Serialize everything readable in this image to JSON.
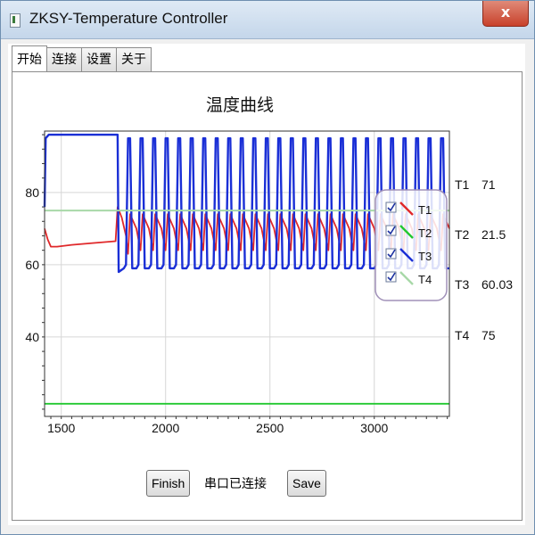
{
  "window": {
    "title": "ZKSY-Temperature Controller",
    "close_glyph": "x",
    "icon": "app-icon"
  },
  "tabs": [
    {
      "label": "开始",
      "active": true
    },
    {
      "label": "连接",
      "active": false
    },
    {
      "label": "设置",
      "active": false
    },
    {
      "label": "关于",
      "active": false
    }
  ],
  "chart_data": {
    "type": "line",
    "title": "温度曲线",
    "xlabel": "",
    "ylabel": "",
    "xlim": [
      1420,
      3360
    ],
    "ylim": [
      18,
      97
    ],
    "xticks": [
      1500,
      2000,
      2500,
      3000
    ],
    "yticks": [
      40,
      60,
      80
    ],
    "grid": true,
    "legend_position": "top-right",
    "series": [
      {
        "name": "T1",
        "color": "#e0282a",
        "values": [
          [
            1420,
            70
          ],
          [
            1435,
            67
          ],
          [
            1450,
            65
          ],
          [
            1480,
            65
          ],
          [
            1550,
            65.5
          ],
          [
            1650,
            66
          ],
          [
            1760,
            66.5
          ],
          [
            1770,
            76
          ],
          [
            1790,
            73
          ],
          [
            1810,
            68
          ],
          [
            1820,
            63
          ],
          [
            1830,
            74
          ],
          [
            1860,
            70
          ],
          [
            1880,
            64
          ],
          [
            1890,
            74
          ],
          [
            1920,
            70
          ],
          [
            1940,
            64
          ],
          [
            1950,
            74
          ],
          [
            1980,
            70
          ],
          [
            2000,
            64
          ],
          [
            2010,
            74
          ],
          [
            2040,
            70
          ],
          [
            2060,
            64
          ],
          [
            2070,
            74
          ],
          [
            2100,
            70
          ],
          [
            2120,
            64
          ],
          [
            2130,
            74
          ],
          [
            2160,
            70
          ],
          [
            2180,
            64
          ],
          [
            2190,
            74
          ],
          [
            2220,
            70
          ],
          [
            2240,
            64
          ],
          [
            2250,
            74
          ],
          [
            2280,
            70
          ],
          [
            2300,
            64
          ],
          [
            2310,
            74
          ],
          [
            2340,
            70
          ],
          [
            2360,
            64
          ],
          [
            2370,
            74
          ],
          [
            2400,
            70
          ],
          [
            2420,
            64
          ],
          [
            2430,
            74
          ],
          [
            2460,
            70
          ],
          [
            2480,
            64
          ],
          [
            2490,
            74
          ],
          [
            2520,
            70
          ],
          [
            2540,
            64
          ],
          [
            2550,
            74
          ],
          [
            2580,
            70
          ],
          [
            2600,
            64
          ],
          [
            2610,
            74
          ],
          [
            2640,
            70
          ],
          [
            2660,
            64
          ],
          [
            2670,
            74
          ],
          [
            2700,
            70
          ],
          [
            2720,
            64
          ],
          [
            2730,
            74
          ],
          [
            2760,
            70
          ],
          [
            2780,
            64
          ],
          [
            2790,
            74
          ],
          [
            2820,
            70
          ],
          [
            2840,
            64
          ],
          [
            2850,
            74
          ],
          [
            2880,
            70
          ],
          [
            2900,
            64
          ],
          [
            2910,
            74
          ],
          [
            2940,
            70
          ],
          [
            2960,
            64
          ],
          [
            2970,
            74
          ],
          [
            3000,
            70
          ],
          [
            3020,
            64
          ],
          [
            3030,
            74
          ],
          [
            3060,
            70
          ],
          [
            3080,
            64
          ],
          [
            3090,
            74
          ],
          [
            3120,
            70
          ],
          [
            3140,
            64
          ],
          [
            3150,
            74
          ],
          [
            3180,
            70
          ],
          [
            3200,
            64
          ],
          [
            3210,
            74
          ],
          [
            3240,
            70
          ],
          [
            3260,
            64
          ],
          [
            3270,
            74
          ],
          [
            3300,
            70
          ],
          [
            3320,
            64
          ],
          [
            3330,
            74
          ],
          [
            3360,
            70
          ]
        ]
      },
      {
        "name": "T2",
        "color": "#22c830",
        "values": [
          [
            1420,
            21.5
          ],
          [
            3360,
            21.5
          ]
        ]
      },
      {
        "name": "T3",
        "color": "#1a2fd6",
        "values": [
          [
            1420,
            76
          ],
          [
            1425,
            95
          ],
          [
            1440,
            96
          ],
          [
            1760,
            96
          ],
          [
            1770,
            96
          ],
          [
            1775,
            58
          ],
          [
            1800,
            59
          ],
          [
            1810,
            60
          ],
          [
            1820,
            95
          ],
          [
            1830,
            95
          ],
          [
            1840,
            59
          ],
          [
            1860,
            59
          ],
          [
            1870,
            60
          ],
          [
            1880,
            95
          ],
          [
            1890,
            95
          ],
          [
            1900,
            59
          ],
          [
            1920,
            59
          ],
          [
            1930,
            60
          ],
          [
            1940,
            95
          ],
          [
            1950,
            95
          ],
          [
            1960,
            59
          ],
          [
            1980,
            59
          ],
          [
            1990,
            60
          ],
          [
            2000,
            95
          ],
          [
            2010,
            95
          ],
          [
            2020,
            59
          ],
          [
            2040,
            59
          ],
          [
            2050,
            60
          ],
          [
            2060,
            95
          ],
          [
            2070,
            95
          ],
          [
            2080,
            59
          ],
          [
            2100,
            59
          ],
          [
            2110,
            60
          ],
          [
            2120,
            95
          ],
          [
            2130,
            95
          ],
          [
            2140,
            59
          ],
          [
            2160,
            59
          ],
          [
            2170,
            60
          ],
          [
            2180,
            95
          ],
          [
            2190,
            95
          ],
          [
            2200,
            59
          ],
          [
            2220,
            59
          ],
          [
            2230,
            60
          ],
          [
            2240,
            95
          ],
          [
            2250,
            95
          ],
          [
            2260,
            59
          ],
          [
            2280,
            59
          ],
          [
            2290,
            60
          ],
          [
            2300,
            95
          ],
          [
            2310,
            95
          ],
          [
            2320,
            59
          ],
          [
            2340,
            59
          ],
          [
            2350,
            60
          ],
          [
            2360,
            95
          ],
          [
            2370,
            95
          ],
          [
            2380,
            59
          ],
          [
            2400,
            59
          ],
          [
            2410,
            60
          ],
          [
            2420,
            95
          ],
          [
            2430,
            95
          ],
          [
            2440,
            59
          ],
          [
            2460,
            59
          ],
          [
            2470,
            60
          ],
          [
            2480,
            95
          ],
          [
            2490,
            95
          ],
          [
            2500,
            59
          ],
          [
            2520,
            59
          ],
          [
            2530,
            60
          ],
          [
            2540,
            95
          ],
          [
            2550,
            95
          ],
          [
            2560,
            59
          ],
          [
            2580,
            59
          ],
          [
            2590,
            60
          ],
          [
            2600,
            95
          ],
          [
            2610,
            95
          ],
          [
            2620,
            59
          ],
          [
            2640,
            59
          ],
          [
            2650,
            60
          ],
          [
            2660,
            95
          ],
          [
            2670,
            95
          ],
          [
            2680,
            59
          ],
          [
            2700,
            59
          ],
          [
            2710,
            60
          ],
          [
            2720,
            95
          ],
          [
            2730,
            95
          ],
          [
            2740,
            59
          ],
          [
            2760,
            59
          ],
          [
            2770,
            60
          ],
          [
            2780,
            95
          ],
          [
            2790,
            95
          ],
          [
            2800,
            59
          ],
          [
            2820,
            59
          ],
          [
            2830,
            60
          ],
          [
            2840,
            95
          ],
          [
            2850,
            95
          ],
          [
            2860,
            59
          ],
          [
            2880,
            59
          ],
          [
            2890,
            60
          ],
          [
            2900,
            95
          ],
          [
            2910,
            95
          ],
          [
            2920,
            59
          ],
          [
            2940,
            59
          ],
          [
            2950,
            60
          ],
          [
            2960,
            95
          ],
          [
            2970,
            95
          ],
          [
            2980,
            59
          ],
          [
            3000,
            59
          ],
          [
            3010,
            60
          ],
          [
            3020,
            95
          ],
          [
            3030,
            95
          ],
          [
            3040,
            59
          ],
          [
            3060,
            59
          ],
          [
            3070,
            60
          ],
          [
            3080,
            95
          ],
          [
            3090,
            95
          ],
          [
            3100,
            59
          ],
          [
            3120,
            59
          ],
          [
            3130,
            60
          ],
          [
            3140,
            95
          ],
          [
            3150,
            95
          ],
          [
            3160,
            59
          ],
          [
            3180,
            59
          ],
          [
            3190,
            60
          ],
          [
            3200,
            95
          ],
          [
            3210,
            95
          ],
          [
            3220,
            59
          ],
          [
            3240,
            59
          ],
          [
            3250,
            60
          ],
          [
            3260,
            95
          ],
          [
            3270,
            95
          ],
          [
            3280,
            59
          ],
          [
            3300,
            59
          ],
          [
            3310,
            60
          ],
          [
            3320,
            95
          ],
          [
            3330,
            95
          ],
          [
            3340,
            59
          ],
          [
            3360,
            59
          ]
        ]
      },
      {
        "name": "T4",
        "color": "#a8d8a8",
        "values": [
          [
            1420,
            75
          ],
          [
            3360,
            75
          ]
        ]
      }
    ]
  },
  "readouts": [
    {
      "label": "T1",
      "value": "71"
    },
    {
      "label": "T2",
      "value": "21.5"
    },
    {
      "label": "T3",
      "value": "60.03"
    },
    {
      "label": "T4",
      "value": "75"
    }
  ],
  "controls": {
    "finish_label": "Finish",
    "status_text": "串口已连接",
    "save_label": "Save"
  }
}
